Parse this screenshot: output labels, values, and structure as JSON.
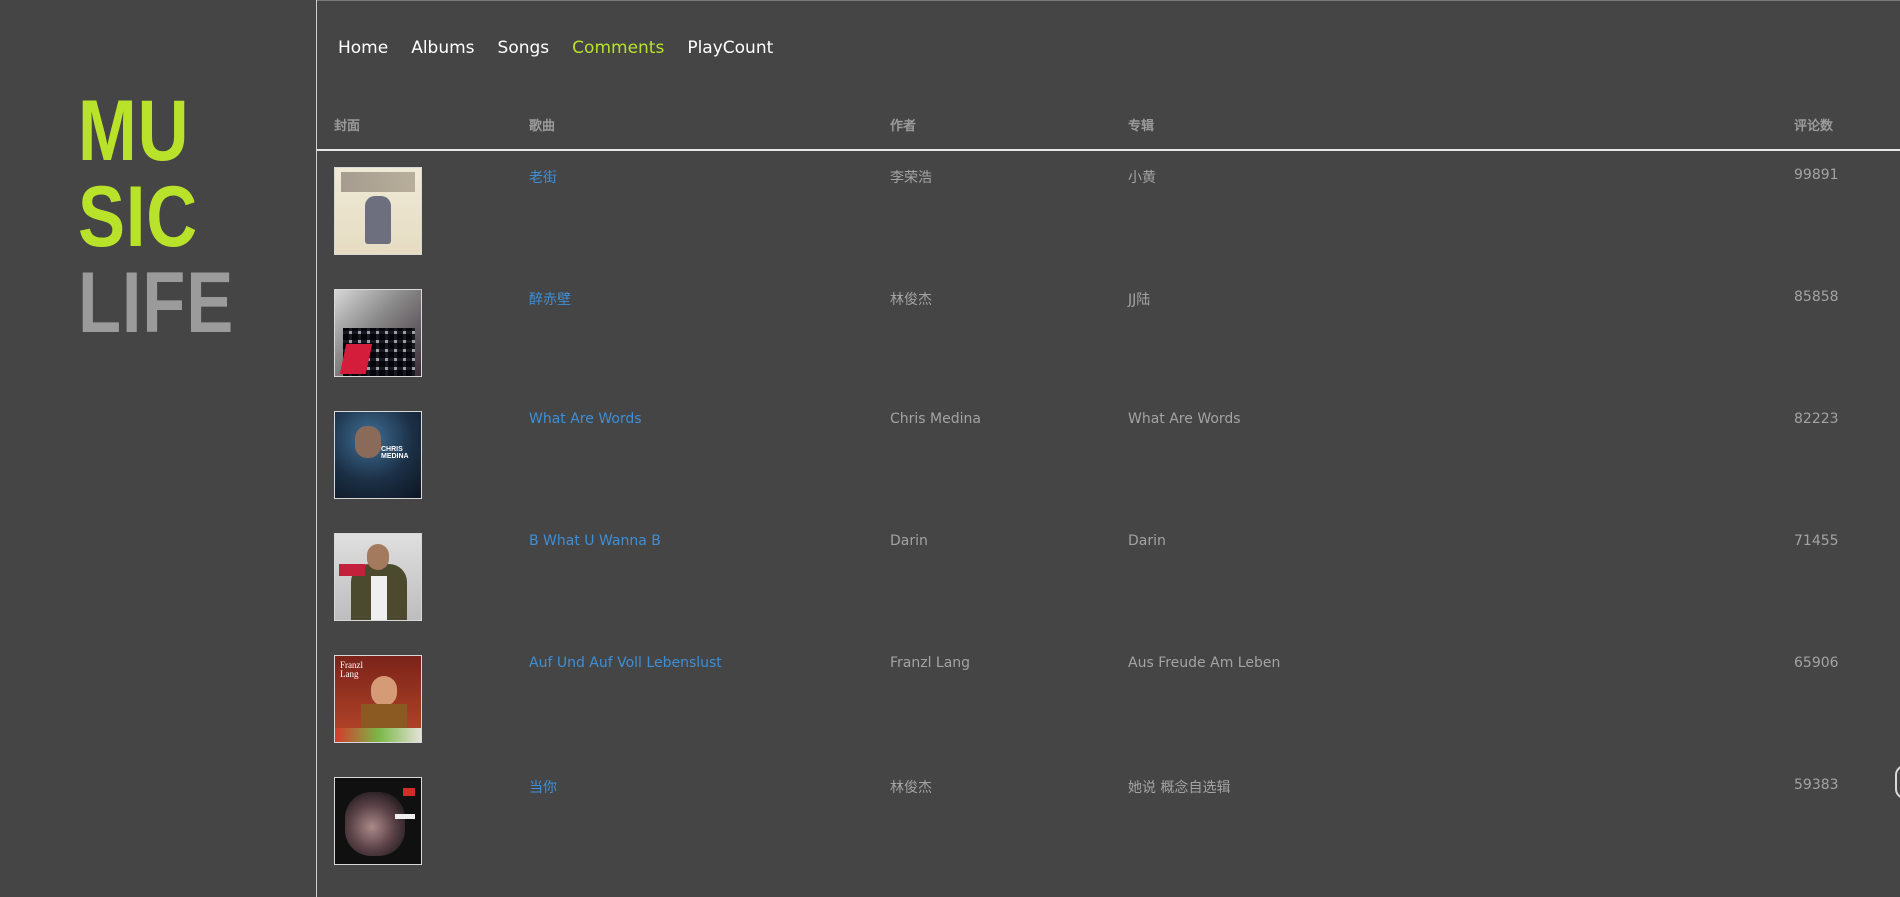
{
  "brand": {
    "line1": "MU",
    "line2": "SIC",
    "line3": "LIFE"
  },
  "nav": [
    {
      "label": "Home",
      "active": false
    },
    {
      "label": "Albums",
      "active": false
    },
    {
      "label": "Songs",
      "active": false
    },
    {
      "label": "Comments",
      "active": true
    },
    {
      "label": "PlayCount",
      "active": false
    }
  ],
  "table": {
    "headers": {
      "cover": "封面",
      "song": "歌曲",
      "artist": "作者",
      "album": "专辑",
      "comments": "评论数"
    },
    "rows": [
      {
        "song": "老街",
        "artist": "李荣浩",
        "album": "小黄",
        "comments": "99891"
      },
      {
        "song": "醉赤壁",
        "artist": "林俊杰",
        "album": "JJ陆",
        "comments": "85858"
      },
      {
        "song": "What Are Words",
        "artist": "Chris Medina",
        "album": "What Are Words",
        "comments": "82223"
      },
      {
        "song": "B What U Wanna B",
        "artist": "Darin",
        "album": "Darin",
        "comments": "71455"
      },
      {
        "song": "Auf Und Auf Voll Lebenslust",
        "artist": "Franzl Lang",
        "album": "Aus Freude Am Leben",
        "comments": "65906"
      },
      {
        "song": "当你",
        "artist": "林俊杰",
        "album": "她说 概念自选辑",
        "comments": "59383"
      }
    ]
  },
  "colors": {
    "accent": "#b9e32a",
    "link": "#3e8fd6",
    "background": "#454545",
    "muted": "#9b9b9b"
  }
}
